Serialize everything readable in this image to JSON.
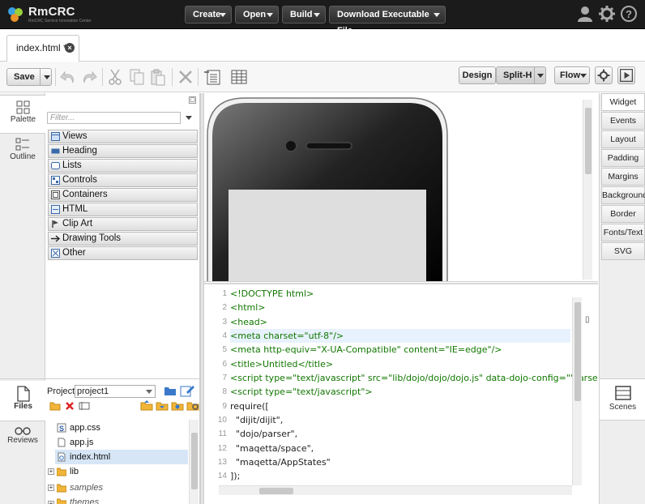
{
  "app": {
    "logo_text": "RmCRC",
    "logo_sub": "RmCRC Service Innovation Center"
  },
  "top_menu": {
    "create": "Create",
    "open": "Open",
    "build": "Build",
    "download": "Download Executable File"
  },
  "top_icons": [
    "user-icon",
    "gear-icon",
    "help-icon"
  ],
  "document_tab": {
    "label": "index.html *"
  },
  "toolbar": {
    "save": "Save",
    "design": "Design",
    "split": "Split-H",
    "flow": "Flow"
  },
  "left_tabs": {
    "palette": "Palette",
    "outline": "Outline",
    "files": "Files",
    "reviews": "Reviews"
  },
  "palette": {
    "filter_placeholder": "Filter...",
    "items": [
      "Views",
      "Heading",
      "Lists",
      "Controls",
      "Containers",
      "HTML",
      "Clip Art",
      "Drawing Tools",
      "Other"
    ]
  },
  "right_tabs": [
    "Widget",
    "Events",
    "Layout",
    "Padding",
    "Margins",
    "Background",
    "Border",
    "Fonts/Text",
    "SVG"
  ],
  "scenes_label": "Scenes",
  "files": {
    "project_label": "Project:",
    "project_value": "project1",
    "tree": [
      {
        "label": "app.css",
        "type": "css"
      },
      {
        "label": "app.js",
        "type": "js"
      },
      {
        "label": "index.html",
        "type": "html",
        "selected": true
      },
      {
        "label": "lib",
        "type": "folder"
      },
      {
        "label": "samples",
        "type": "folder-italic"
      },
      {
        "label": "themes",
        "type": "folder-italic"
      }
    ]
  },
  "code": {
    "lines": [
      "<!DOCTYPE html>",
      "<html>",
      "<head>",
      "<meta charset=\"utf-8\"/>",
      "<meta http-equiv=\"X-UA-Compatible\" content=\"IE=edge\"/>",
      "<title>Untitled</title>",
      "<script type=\"text/javascript\" src=\"lib/dojo/dojo/dojo.js\" data-dojo-config=\"'parse",
      "<script type=\"text/javascript\">",
      "require([",
      "  \"dijit/dijit\",",
      "  \"dojo/parser\",",
      "  \"maqetta/space\",",
      "  \"maqetta/AppStates\"",
      "]);"
    ],
    "line_numbers": [
      "1",
      "2",
      "3",
      "4",
      "5",
      "6",
      "7",
      "8",
      "9",
      "10",
      "11",
      "12",
      "13",
      "14"
    ],
    "highlighted_line": 4
  },
  "colors": {
    "topbar": "#1b1b1b",
    "tag": "#117700",
    "attr": "#0000cc",
    "string": "#aa1111",
    "highlight": "#e8f2fe"
  }
}
